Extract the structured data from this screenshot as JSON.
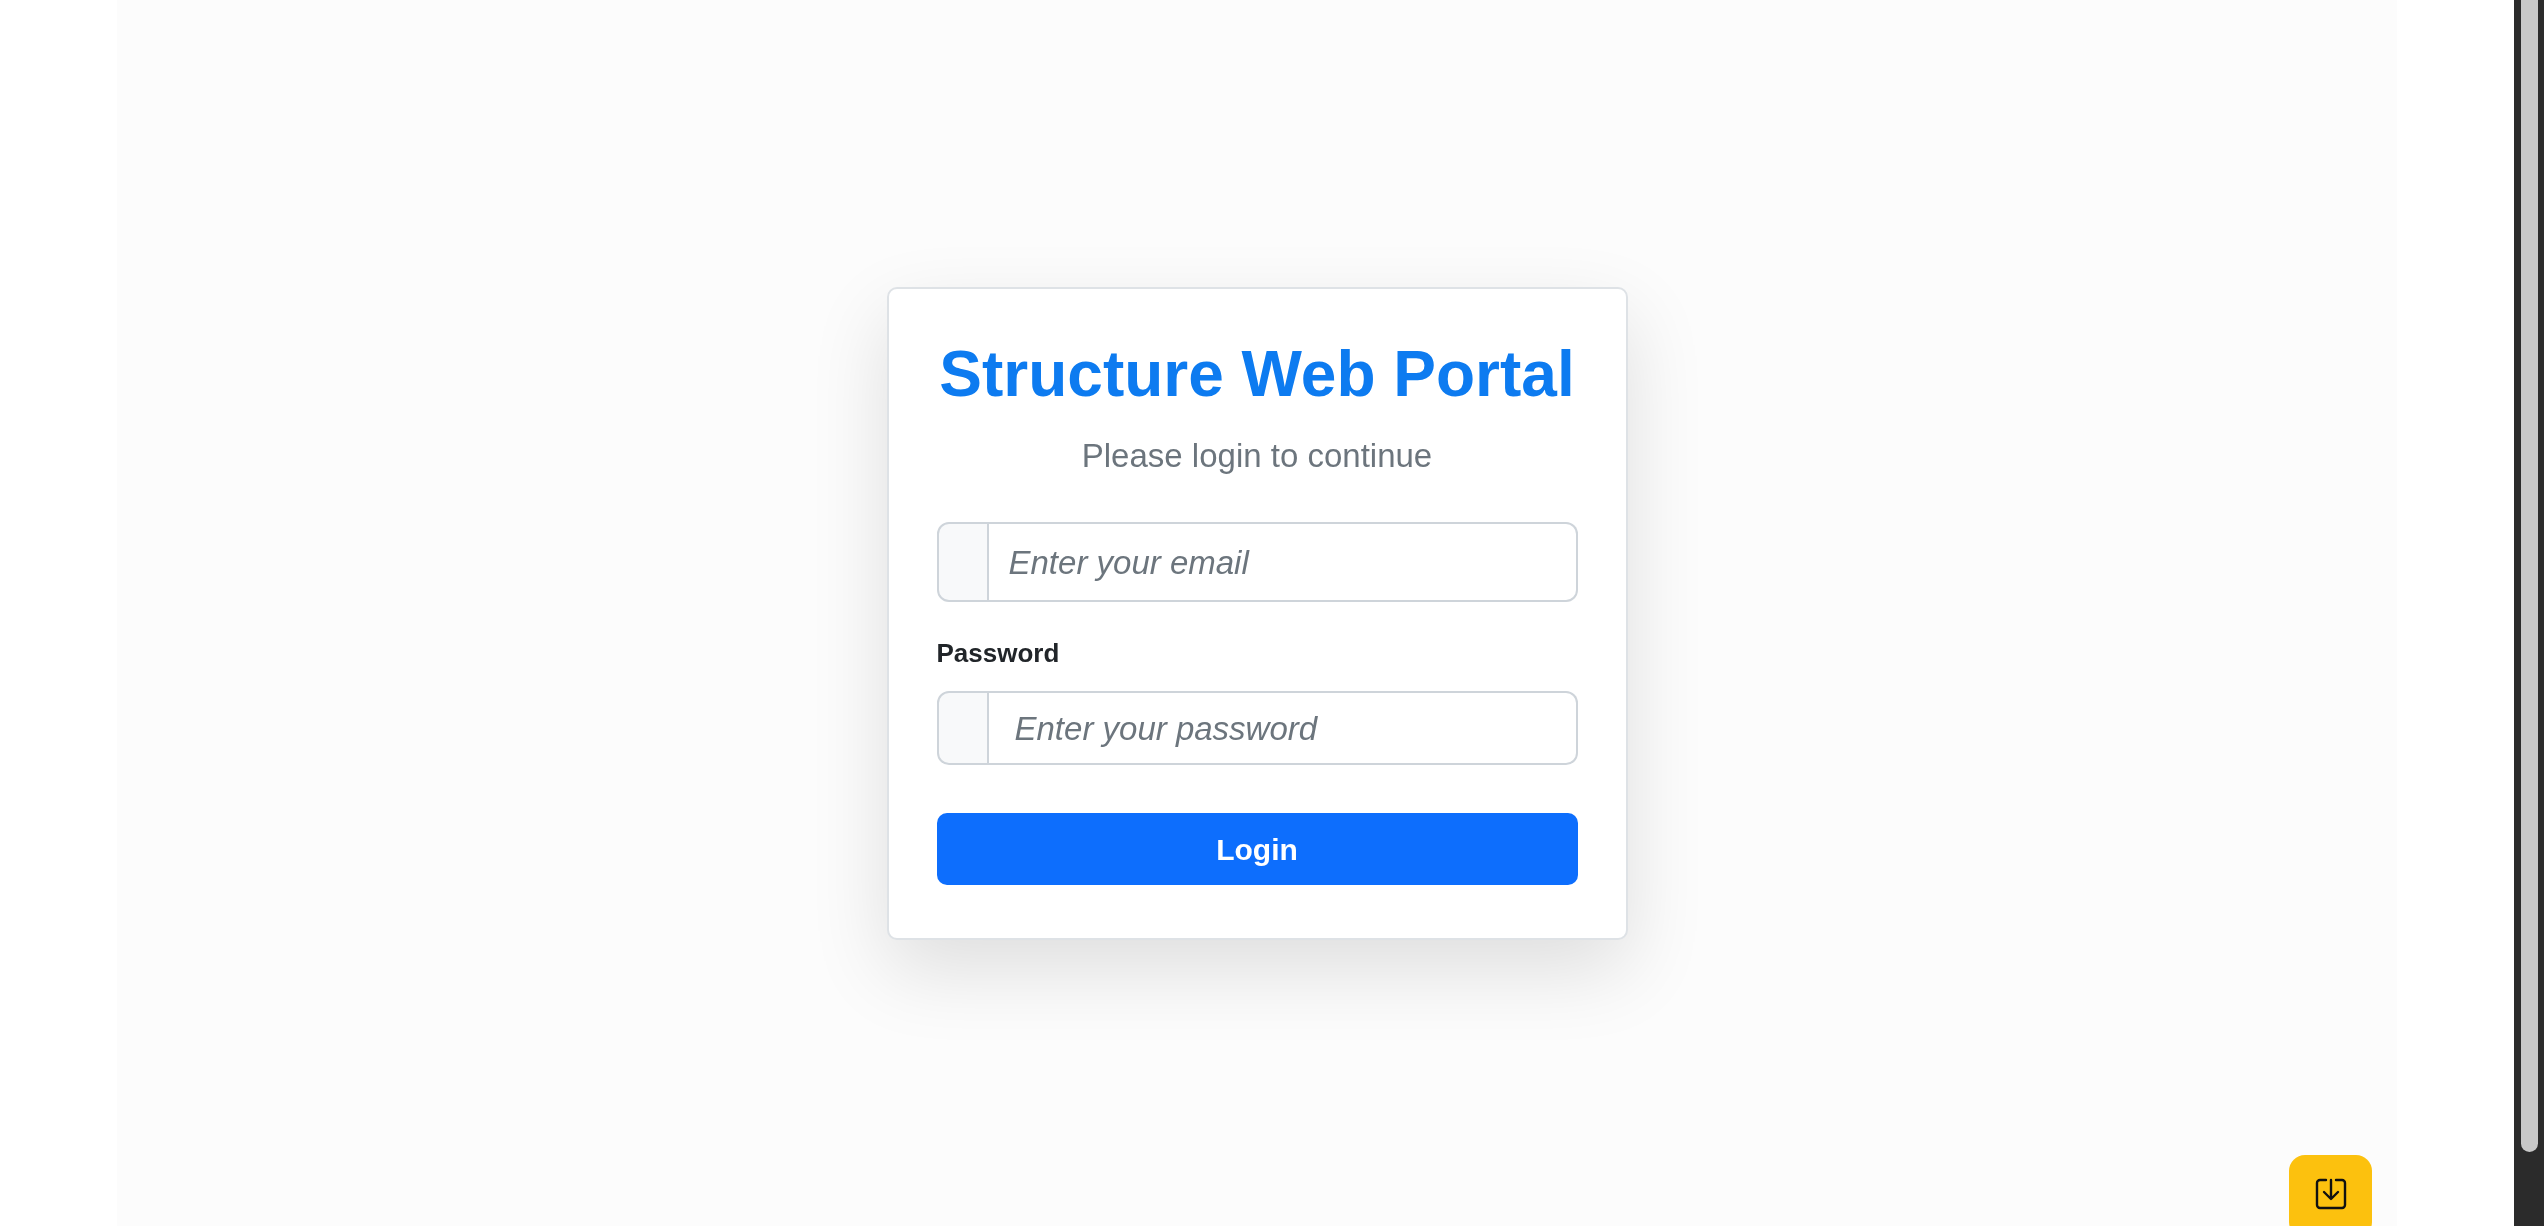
{
  "login_card": {
    "title": "Structure Web Portal",
    "subtitle": "Please login to continue",
    "fields": [
      {
        "kind": "email",
        "placeholder": "Enter your email"
      },
      {
        "kind": "password",
        "label": "Password",
        "placeholder": "Enter your password"
      }
    ],
    "submit_button": "Login"
  },
  "floating_button": {
    "kind": "download"
  }
}
